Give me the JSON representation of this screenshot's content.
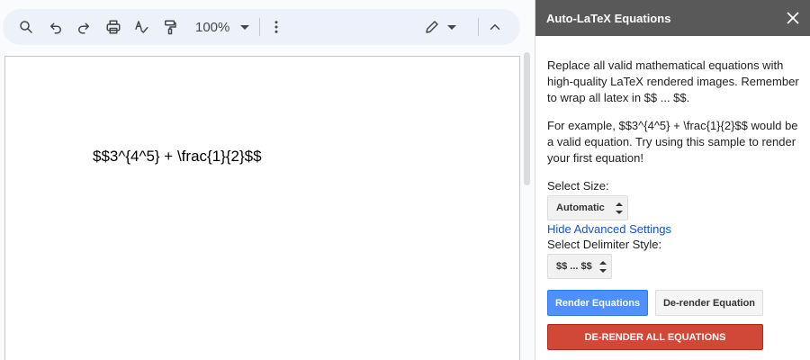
{
  "toolbar": {
    "zoom": "100%",
    "icons": [
      "search-icon",
      "undo-icon",
      "redo-icon",
      "print-icon",
      "spellcheck-icon",
      "paint-format-icon",
      "more-vert-icon",
      "pencil-icon",
      "chevron-up-icon"
    ]
  },
  "document": {
    "text": "$$3^{4^5} + \\frac{1}{2}$$"
  },
  "sidebar": {
    "title": "Auto-LaTeX Equations",
    "intro": "Replace all valid mathematical equations with high-quality LaTeX rendered images. Remember to wrap all latex in $$ ... $$.",
    "example": "For example, $$3^{4^5} + \\frac{1}{2}$$ would be a valid equation. Try using this sample to render your first equation!",
    "size_label": "Select Size:",
    "size_value": "Automatic",
    "advanced_link": "Hide Advanced Settings",
    "delimiter_label": "Select Delimiter Style:",
    "delimiter_value": "$$ ... $$",
    "render_button": "Render Equations",
    "derender_button": "De-render Equation",
    "derender_all_button": "DE-RENDER ALL EQUATIONS"
  },
  "colors": {
    "header_bg": "#595959",
    "render_blue": "#4d90fe",
    "derender_all_red": "#d14836",
    "link_blue": "#1155cc",
    "toolbar_bg": "#edf2fa"
  }
}
